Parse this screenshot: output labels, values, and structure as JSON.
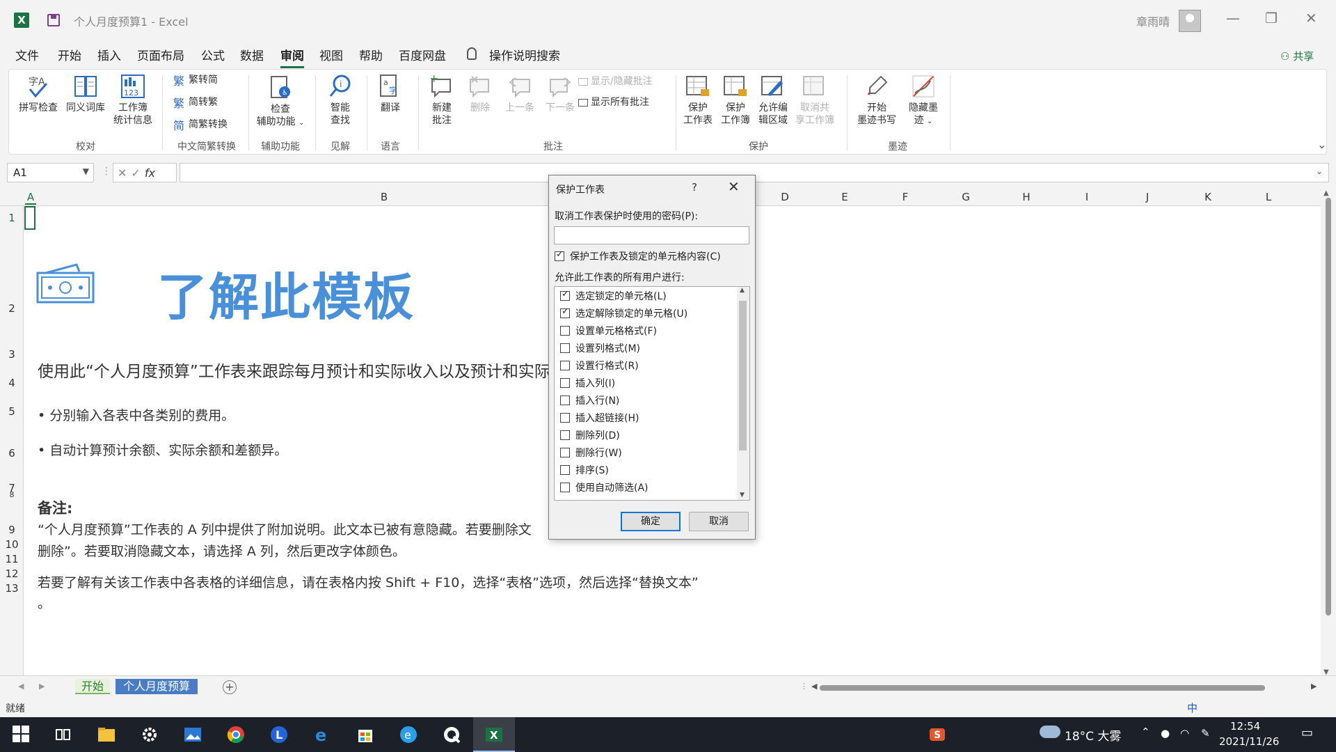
{
  "window": {
    "title": "个人月度预算1 - Excel",
    "user": "章雨晴",
    "share_label": "共享",
    "app_icon_letter": "X"
  },
  "menu": {
    "tabs": [
      "文件",
      "开始",
      "插入",
      "页面布局",
      "公式",
      "数据",
      "审阅",
      "视图",
      "帮助",
      "百度网盘",
      "操作说明搜索"
    ],
    "active": "审阅"
  },
  "ribbon": {
    "proofing": {
      "spell": "拼写检查",
      "thesaurus": "同义词库",
      "stats_line1": "工作簿",
      "stats_line2": "统计信息",
      "group": "校对"
    },
    "chinese": {
      "to_simplified": "繁转简",
      "to_traditional": "简转繁",
      "convert": "简繁转换",
      "group": "中文简繁转换"
    },
    "accessibility": {
      "line1": "检查",
      "line2": "辅助功能",
      "group": "辅助功能"
    },
    "insights": {
      "line1": "智能",
      "line2": "查找",
      "group": "见解"
    },
    "language": {
      "translate": "翻译",
      "group": "语言"
    },
    "comments": {
      "new_line1": "新建",
      "new_line2": "批注",
      "delete": "删除",
      "previous": "上一条",
      "next": "下一条",
      "show_hide": "显示/隐藏批注",
      "show_all": "显示所有批注",
      "group": "批注"
    },
    "protect": {
      "sheet_line1": "保护",
      "sheet_line2": "工作表",
      "workbook_line1": "保护",
      "workbook_line2": "工作簿",
      "allow_line1": "允许编",
      "allow_line2": "辑区域",
      "unshare_line1": "取消共",
      "unshare_line2": "享工作簿",
      "group": "保护"
    },
    "ink": {
      "start_line1": "开始",
      "start_line2": "墨迹书写",
      "hide_line1": "隐藏墨",
      "hide_line2": "迹",
      "group": "墨迹"
    }
  },
  "formula_bar": {
    "name_box": "A1",
    "fx": "fx",
    "formula": ""
  },
  "columns": [
    "A",
    "B",
    "C",
    "D",
    "E",
    "F",
    "G",
    "H",
    "I",
    "J",
    "K",
    "L"
  ],
  "rows": [
    "1",
    "2",
    "3",
    "4",
    "5",
    "6",
    "7",
    "8",
    "9",
    "10",
    "11",
    "12",
    "13"
  ],
  "content": {
    "title": "了解此模板",
    "description": "使用此“个人月度预算”工作表来跟踪每月预计和实际收入以及预计和实际",
    "bullet1": "• 分别输入各表中各类别的费用。",
    "bullet2": "• 自动计算预计余额、实际余额和差额异。",
    "note_title": "备注:",
    "note_line1": "“个人月度预算”工作表的 A 列中提供了附加说明。此文本已被有意隐藏。若要删除文",
    "note_line2": "删除”。若要取消隐藏文本，请选择 A 列，然后更改字体颜色。",
    "note_line3": "若要了解有关该工作表中各表格的详细信息，请在表格内按 Shift + F10，选择“表格”选项，然后选择“替换文本”",
    "note_line4": "。"
  },
  "dialog": {
    "title": "保护工作表",
    "help": "?",
    "password_label": "取消工作表保护时使用的密码(P):",
    "password_value": "",
    "protect_check_label": "保护工作表及锁定的单元格内容(C)",
    "protect_checked": true,
    "allow_label": "允许此工作表的所有用户进行:",
    "options": [
      {
        "label": "选定锁定的单元格(L)",
        "checked": true
      },
      {
        "label": "选定解除锁定的单元格(U)",
        "checked": true
      },
      {
        "label": "设置单元格格式(F)",
        "checked": false
      },
      {
        "label": "设置列格式(M)",
        "checked": false
      },
      {
        "label": "设置行格式(R)",
        "checked": false
      },
      {
        "label": "插入列(I)",
        "checked": false
      },
      {
        "label": "插入行(N)",
        "checked": false
      },
      {
        "label": "插入超链接(H)",
        "checked": false
      },
      {
        "label": "删除列(D)",
        "checked": false
      },
      {
        "label": "删除行(W)",
        "checked": false
      },
      {
        "label": "排序(S)",
        "checked": false
      },
      {
        "label": "使用自动筛选(A)",
        "checked": false
      }
    ],
    "ok": "确定",
    "cancel": "取消"
  },
  "sheet_tabs": [
    "开始",
    "个人月度预算"
  ],
  "status": "就绪",
  "taskbar": {
    "weather": "18°C 大雾",
    "time": "12:54",
    "date": "2021/11/26",
    "ime": "中"
  },
  "colors": {
    "excel_green": "#1e7145",
    "title_blue": "#4a90d9",
    "active_tab_blue": "#4a7cc4",
    "dialog_default_border": "#0078d7"
  }
}
